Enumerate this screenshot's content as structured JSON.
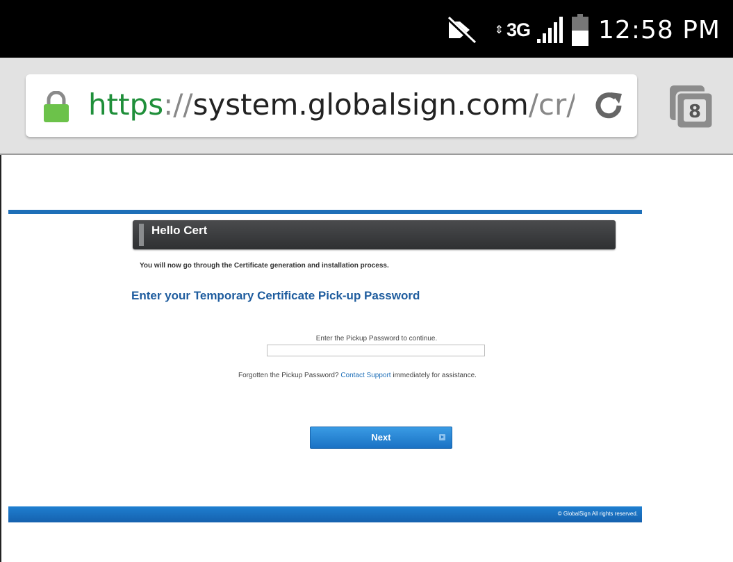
{
  "status_bar": {
    "network": "3G",
    "time": "12:58 PM",
    "icons": [
      "mute-icon",
      "data-arrows-icon",
      "signal-icon",
      "battery-icon"
    ]
  },
  "browser": {
    "url_scheme": "https",
    "url_sep": "://",
    "url_host": "system.globalsign.com",
    "url_path": "/cr/p",
    "tab_count": "8",
    "icons": [
      "lock-icon",
      "reload-icon",
      "tabs-icon"
    ]
  },
  "page": {
    "panel_title": "Hello Cert",
    "intro": "You will now go through the Certificate generation and installation process.",
    "heading": "Enter your Temporary Certificate Pick-up Password",
    "password_label": "Enter the Pickup Password to continue.",
    "password_value": "",
    "forgot_prefix": "Forgotten the Pickup Password? ",
    "forgot_link": "Contact Support",
    "forgot_suffix": " immediately for assistance.",
    "next_label": "Next",
    "footer": "© GlobalSign All rights reserved."
  },
  "colors": {
    "accent": "#1e6fb8",
    "heading": "#1e5c9e",
    "secure_scheme": "#1f8f3a",
    "panel": "#3a3b3d"
  }
}
